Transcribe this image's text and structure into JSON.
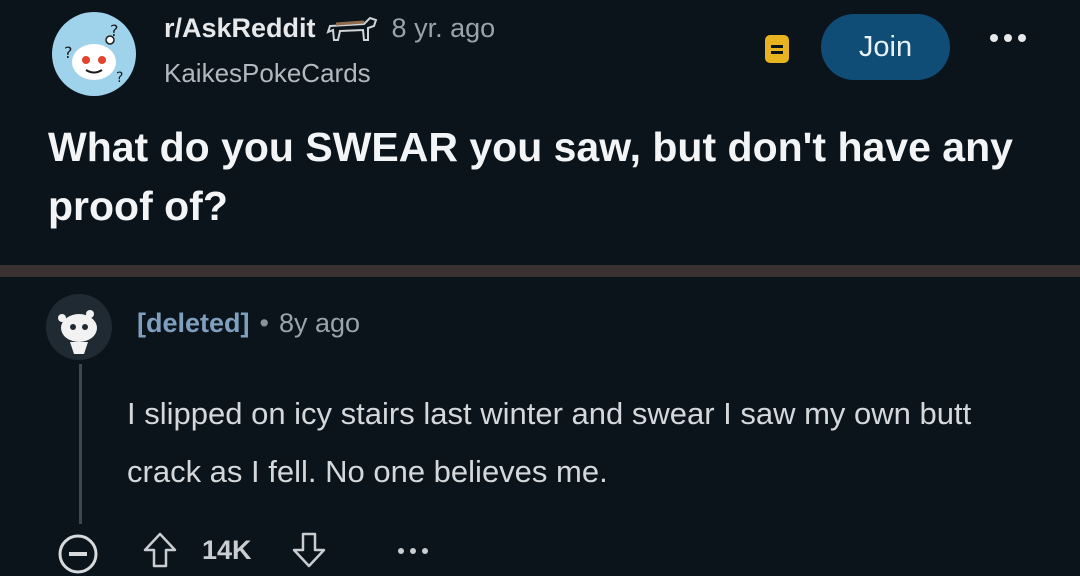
{
  "post": {
    "subreddit": "r/AskReddit",
    "age": "8 yr. ago",
    "author": "KaikesPokeCards",
    "join_label": "Join",
    "title": "What do you SWEAR you saw, but don't have any proof of?",
    "icons": {
      "avatar": "askreddit-snoo-avatar-icon",
      "flair": "horse-icon",
      "bookmark": "bookmark-icon",
      "more": "more-options-icon"
    }
  },
  "comment": {
    "author": "[deleted]",
    "separator": "•",
    "age": "8y ago",
    "body": "I slipped on icy stairs last winter and swear I saw my own butt crack as I fell. No one believes me.",
    "votes": "14K",
    "icons": {
      "avatar": "deleted-user-avatar-icon",
      "collapse": "collapse-icon",
      "upvote": "upvote-arrow-icon",
      "downvote": "downvote-arrow-icon",
      "more": "more-options-icon"
    }
  },
  "colors": {
    "background": "#0b141b",
    "join_button": "#0f4c76",
    "bookmark": "#e8b320",
    "divider": "#3a3230",
    "comment_author": "#7f9fbe"
  }
}
